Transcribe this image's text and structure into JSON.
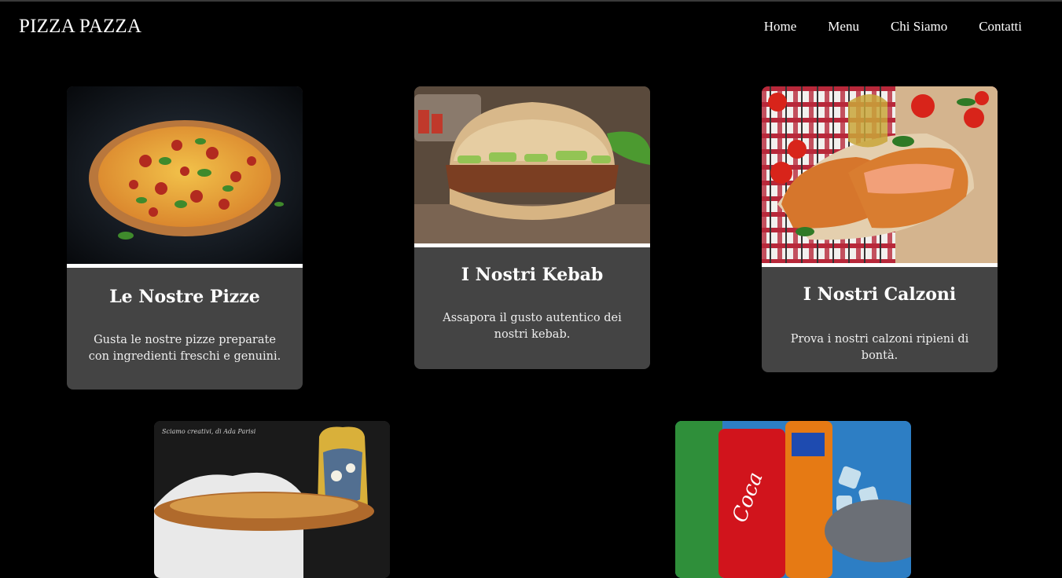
{
  "site": {
    "logo": "PIZZA PAZZA"
  },
  "nav": {
    "items": [
      "Home",
      "Menu",
      "Chi Siamo",
      "Contatti"
    ]
  },
  "cards": [
    {
      "title": "Le Nostre Pizze",
      "description": "Gusta le nostre pizze preparate con ingredienti freschi e genuini.",
      "image": "pizza-photo"
    },
    {
      "title": "I Nostri Kebab",
      "description": "Assapora il gusto autentico dei nostri kebab.",
      "image": "kebab-photo"
    },
    {
      "title": "I Nostri Calzoni",
      "description": "Prova i nostri calzoni ripieni di bontà.",
      "image": "calzone-photo"
    },
    {
      "title": "",
      "description": "",
      "image": "dessert-photo",
      "watermark": "Sciamo creativi, di Ada Parisi"
    },
    {
      "title": "",
      "description": "",
      "image": "drinks-photo"
    }
  ],
  "colors": {
    "background": "#000000",
    "card": "#444444",
    "separator": "#ffffff",
    "text": "#ffffff"
  }
}
